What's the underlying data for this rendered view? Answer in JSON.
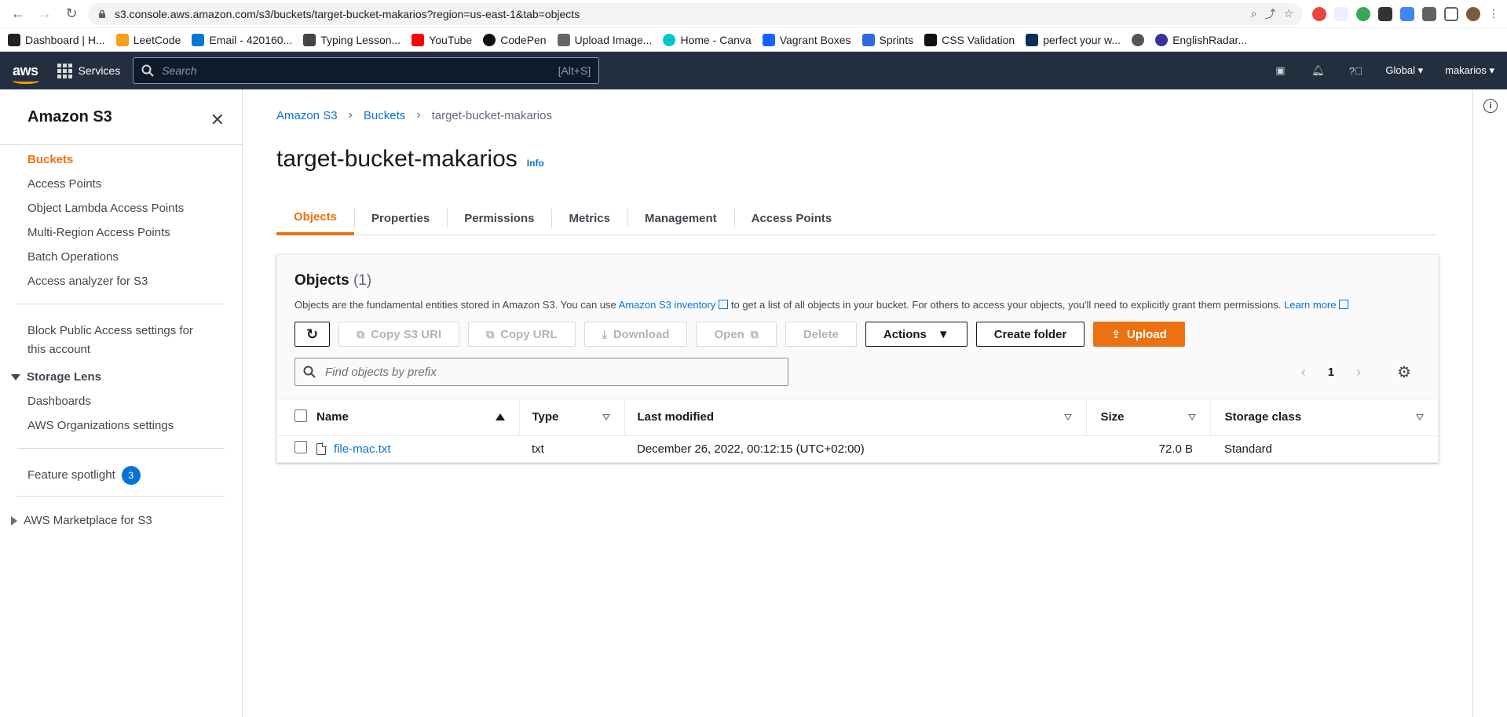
{
  "browser": {
    "url": "s3.console.aws.amazon.com/s3/buckets/target-bucket-makarios?region=us-east-1&tab=objects",
    "bookmarks": [
      "Dashboard | H...",
      "LeetCode",
      "Email - 420160...",
      "Typing Lesson...",
      "YouTube",
      "CodePen",
      "Upload Image...",
      "Home - Canva",
      "Vagrant Boxes",
      "Sprints",
      "CSS Validation",
      "perfect your w...",
      "",
      "EnglishRadar..."
    ]
  },
  "aws_nav": {
    "logo": "aws",
    "services": "Services",
    "search_placeholder": "Search",
    "search_hint": "[Alt+S]",
    "region": "Global",
    "user": "makarios"
  },
  "sidebar": {
    "title": "Amazon S3",
    "items": [
      "Buckets",
      "Access Points",
      "Object Lambda Access Points",
      "Multi-Region Access Points",
      "Batch Operations",
      "Access analyzer for S3"
    ],
    "block_public": "Block Public Access settings for this account",
    "storage_lens": {
      "label": "Storage Lens",
      "items": [
        "Dashboards",
        "AWS Organizations settings"
      ]
    },
    "feature_spotlight": "Feature spotlight",
    "feature_count": "3",
    "marketplace": "AWS Marketplace for S3"
  },
  "breadcrumb": [
    "Amazon S3",
    "Buckets",
    "target-bucket-makarios"
  ],
  "page": {
    "title": "target-bucket-makarios",
    "info": "Info"
  },
  "tabs": [
    "Objects",
    "Properties",
    "Permissions",
    "Metrics",
    "Management",
    "Access Points"
  ],
  "objects": {
    "title": "Objects",
    "count": "(1)",
    "desc_pre": "Objects are the fundamental entities stored in Amazon S3. You can use",
    "desc_link": "Amazon S3 inventory",
    "desc_post": "to get a list of all objects in your bucket. For others to access your objects, you'll need to explicitly grant them permissions.",
    "learn_more": "Learn more",
    "buttons": {
      "copy_s3_uri": "Copy S3 URI",
      "copy_url": "Copy URL",
      "download": "Download",
      "open": "Open",
      "delete": "Delete",
      "actions": "Actions",
      "create_folder": "Create folder",
      "upload": "Upload"
    },
    "search_placeholder": "Find objects by prefix",
    "page": "1",
    "columns": [
      "Name",
      "Type",
      "Last modified",
      "Size",
      "Storage class"
    ],
    "rows": [
      {
        "name": "file-mac.txt",
        "type": "txt",
        "modified": "December 26, 2022, 00:12:15 (UTC+02:00)",
        "size": "72.0 B",
        "storage": "Standard"
      }
    ]
  }
}
